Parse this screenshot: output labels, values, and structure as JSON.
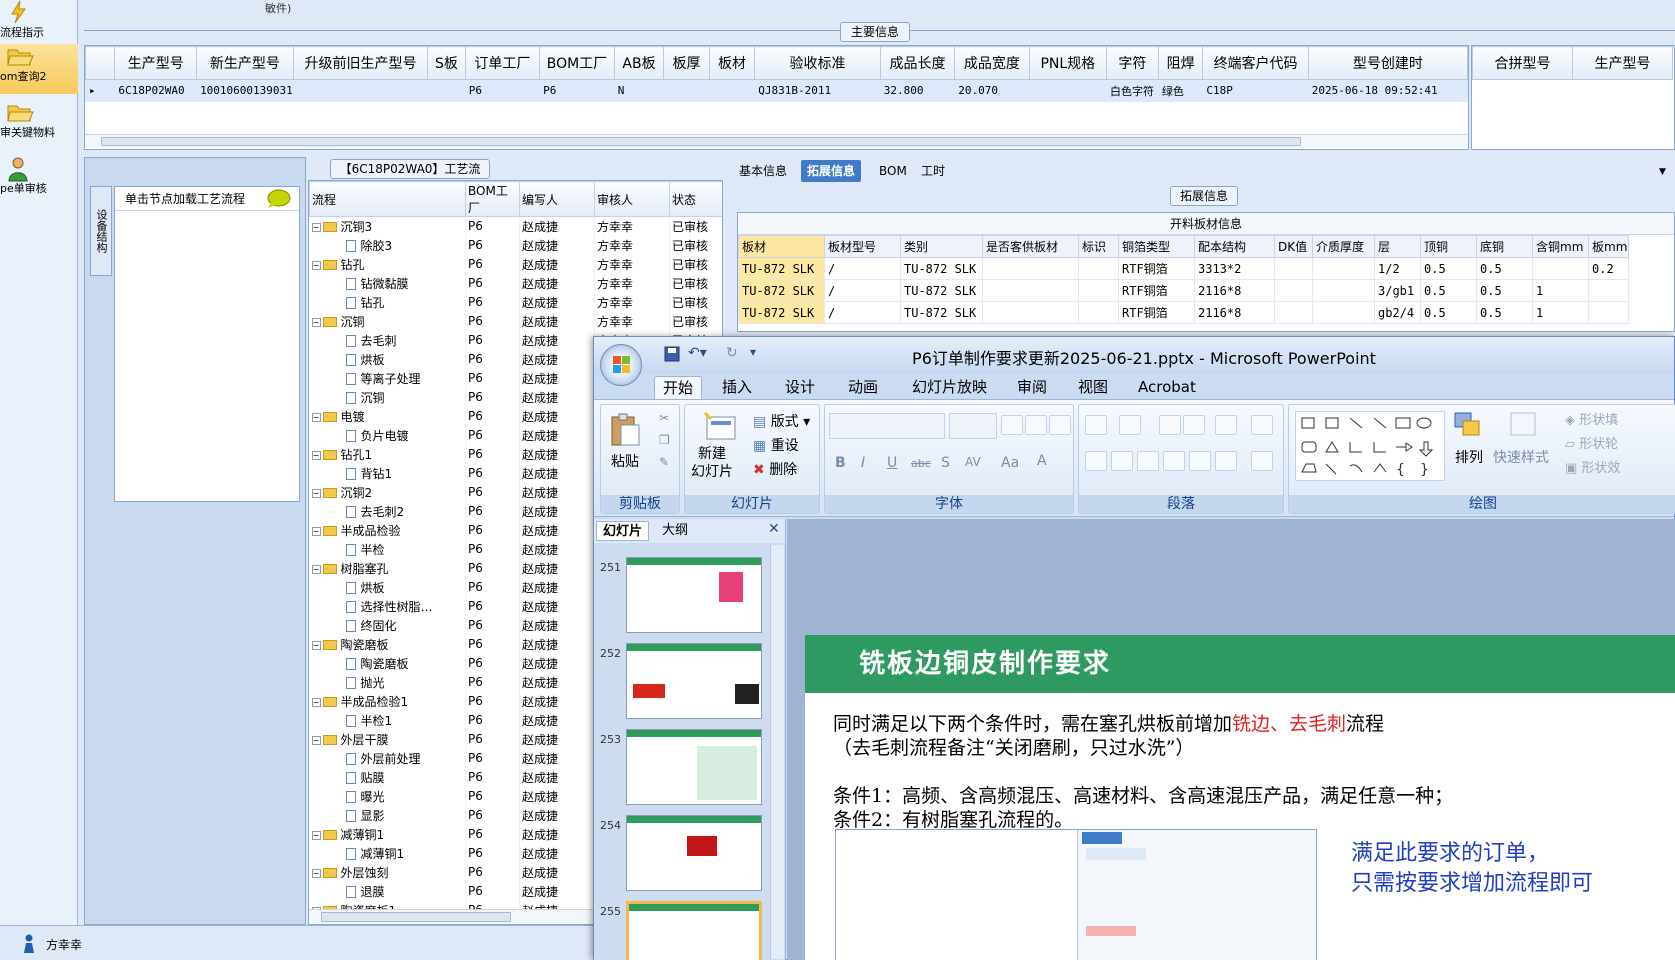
{
  "leftnav": {
    "items": [
      {
        "label": "流程指示",
        "icon": "lightning-icon"
      },
      {
        "label": "om查询2",
        "icon": "folder-open-icon"
      },
      {
        "label": "审关键物料",
        "icon": "folder-open-icon"
      },
      {
        "label": "pe单审核",
        "icon": "user-icon"
      }
    ],
    "top_text": "敏件)"
  },
  "status": {
    "user": "方幸幸"
  },
  "main": {
    "section_title": "主要信息",
    "columns": [
      "生产型号",
      "新生产型号",
      "升级前旧生产型号",
      "S板",
      "订单工厂",
      "BOM工厂",
      "AB板",
      "板厚",
      "板材",
      "验收标准",
      "成品长度",
      "成品宽度",
      "PNL规格",
      "字符",
      "阻焊",
      "终端客户代码",
      "型号创建时"
    ],
    "rows": [
      [
        "6C18P02WA0",
        "10010600139031",
        "",
        "",
        "P6",
        "P6",
        "N",
        "",
        "",
        "QJ831B-2011",
        "32.800",
        "20.070",
        "",
        "白色字符",
        "绿色",
        "C18P",
        "2025-06-18 09:52:41"
      ]
    ]
  },
  "right_grid": {
    "columns": [
      "合拼型号",
      "生产型号"
    ]
  },
  "process": {
    "title": "【6C18P02WA0】工艺流程",
    "vertical_tab": "设备结构",
    "load_hint": "单击节点加载工艺流程",
    "columns": [
      "流程",
      "BOM工厂",
      "编写人",
      "审核人",
      "状态"
    ],
    "rows": [
      {
        "name": "沉铜3",
        "type": "folder",
        "factory": "P6",
        "author": "赵成捷",
        "reviewer": "方幸幸",
        "status": "已审核"
      },
      {
        "name": "除胶3",
        "type": "doc",
        "factory": "P6",
        "author": "赵成捷",
        "reviewer": "方幸幸",
        "status": "已审核"
      },
      {
        "name": "钻孔",
        "type": "folder",
        "factory": "P6",
        "author": "赵成捷",
        "reviewer": "方幸幸",
        "status": "已审核"
      },
      {
        "name": "钻微黏膜",
        "type": "doc",
        "factory": "P6",
        "author": "赵成捷",
        "reviewer": "方幸幸",
        "status": "已审核"
      },
      {
        "name": "钻孔",
        "type": "doc",
        "factory": "P6",
        "author": "赵成捷",
        "reviewer": "方幸幸",
        "status": "已审核"
      },
      {
        "name": "沉铜",
        "type": "folder",
        "factory": "P6",
        "author": "赵成捷",
        "reviewer": "方幸幸",
        "status": "已审核"
      },
      {
        "name": "去毛刺",
        "type": "doc",
        "factory": "P6",
        "author": "赵成捷",
        "reviewer": "方幸幸",
        "status": "已审核"
      },
      {
        "name": "烘板",
        "type": "doc",
        "factory": "P6",
        "author": "赵成捷",
        "reviewer": "",
        "status": ""
      },
      {
        "name": "等离子处理",
        "type": "doc",
        "factory": "P6",
        "author": "赵成捷",
        "reviewer": "",
        "status": ""
      },
      {
        "name": "沉铜",
        "type": "doc",
        "factory": "P6",
        "author": "赵成捷",
        "reviewer": "",
        "status": ""
      },
      {
        "name": "电镀",
        "type": "folder",
        "factory": "P6",
        "author": "赵成捷",
        "reviewer": "",
        "status": ""
      },
      {
        "name": "负片电镀",
        "type": "doc",
        "factory": "P6",
        "author": "赵成捷",
        "reviewer": "",
        "status": ""
      },
      {
        "name": "钻孔1",
        "type": "folder",
        "factory": "P6",
        "author": "赵成捷",
        "reviewer": "",
        "status": ""
      },
      {
        "name": "背钻1",
        "type": "doc",
        "factory": "P6",
        "author": "赵成捷",
        "reviewer": "",
        "status": ""
      },
      {
        "name": "沉铜2",
        "type": "folder",
        "factory": "P6",
        "author": "赵成捷",
        "reviewer": "",
        "status": ""
      },
      {
        "name": "去毛刺2",
        "type": "doc",
        "factory": "P6",
        "author": "赵成捷",
        "reviewer": "",
        "status": ""
      },
      {
        "name": "半成品检验",
        "type": "folder",
        "factory": "P6",
        "author": "赵成捷",
        "reviewer": "",
        "status": ""
      },
      {
        "name": "半检",
        "type": "doc",
        "factory": "P6",
        "author": "赵成捷",
        "reviewer": "",
        "status": ""
      },
      {
        "name": "树脂塞孔",
        "type": "folder",
        "factory": "P6",
        "author": "赵成捷",
        "reviewer": "",
        "status": ""
      },
      {
        "name": "烘板",
        "type": "doc",
        "factory": "P6",
        "author": "赵成捷",
        "reviewer": "",
        "status": ""
      },
      {
        "name": "选择性树脂…",
        "type": "doc",
        "factory": "P6",
        "author": "赵成捷",
        "reviewer": "",
        "status": ""
      },
      {
        "name": "终固化",
        "type": "doc",
        "factory": "P6",
        "author": "赵成捷",
        "reviewer": "",
        "status": ""
      },
      {
        "name": "陶瓷磨板",
        "type": "folder",
        "factory": "P6",
        "author": "赵成捷",
        "reviewer": "",
        "status": ""
      },
      {
        "name": "陶瓷磨板",
        "type": "doc",
        "factory": "P6",
        "author": "赵成捷",
        "reviewer": "",
        "status": ""
      },
      {
        "name": "抛光",
        "type": "doc",
        "factory": "P6",
        "author": "赵成捷",
        "reviewer": "",
        "status": ""
      },
      {
        "name": "半成品检验1",
        "type": "folder",
        "factory": "P6",
        "author": "赵成捷",
        "reviewer": "",
        "status": ""
      },
      {
        "name": "半检1",
        "type": "doc",
        "factory": "P6",
        "author": "赵成捷",
        "reviewer": "",
        "status": ""
      },
      {
        "name": "外层干膜",
        "type": "folder",
        "factory": "P6",
        "author": "赵成捷",
        "reviewer": "",
        "status": ""
      },
      {
        "name": "外层前处理",
        "type": "doc",
        "factory": "P6",
        "author": "赵成捷",
        "reviewer": "",
        "status": ""
      },
      {
        "name": "贴膜",
        "type": "doc",
        "factory": "P6",
        "author": "赵成捷",
        "reviewer": "",
        "status": ""
      },
      {
        "name": "曝光",
        "type": "doc",
        "factory": "P6",
        "author": "赵成捷",
        "reviewer": "",
        "status": ""
      },
      {
        "name": "显影",
        "type": "doc",
        "factory": "P6",
        "author": "赵成捷",
        "reviewer": "",
        "status": ""
      },
      {
        "name": "减薄铜1",
        "type": "folder",
        "factory": "P6",
        "author": "赵成捷",
        "reviewer": "",
        "status": ""
      },
      {
        "name": "减薄铜1",
        "type": "doc",
        "factory": "P6",
        "author": "赵成捷",
        "reviewer": "",
        "status": ""
      },
      {
        "name": "外层蚀刻",
        "type": "folder",
        "factory": "P6",
        "author": "赵成捷",
        "reviewer": "",
        "status": ""
      },
      {
        "name": "退膜",
        "type": "doc",
        "factory": "P6",
        "author": "赵成捷",
        "reviewer": "",
        "status": ""
      },
      {
        "name": "陶瓷磨板1",
        "type": "folder",
        "factory": "P6",
        "author": "赵成捷",
        "reviewer": "",
        "status": ""
      }
    ]
  },
  "detail": {
    "tabs": [
      "基本信息",
      "拓展信息",
      "BOM",
      "工时"
    ],
    "active_tab": "拓展信息",
    "section_title": "拓展信息",
    "table_title": "开料板材信息",
    "columns": [
      "板材",
      "板材型号",
      "类别",
      "是否客供板材",
      "标识",
      "铜箔类型",
      "配本结构",
      "DK值",
      "介质厚度",
      "层",
      "顶铜",
      "底铜",
      "含铜mm",
      "板mm"
    ],
    "rows": [
      [
        "TU-872 SLK",
        "/",
        "TU-872 SLK",
        "",
        "",
        "RTF铜箔",
        "3313*2",
        "",
        "",
        "1/2",
        "0.5",
        "0.5",
        "",
        "0.2"
      ],
      [
        "TU-872 SLK",
        "/",
        "TU-872 SLK",
        "",
        "",
        "RTF铜箔",
        "2116*8",
        "",
        "",
        "3/gb1",
        "0.5",
        "0.5",
        "1",
        ""
      ],
      [
        "TU-872 SLK",
        "/",
        "TU-872 SLK",
        "",
        "",
        "RTF铜箔",
        "2116*8",
        "",
        "",
        "gb2/4",
        "0.5",
        "0.5",
        "1",
        ""
      ]
    ]
  },
  "ppt": {
    "title": "P6订单制作要求更新2025-06-21.pptx - Microsoft PowerPoint",
    "menu_tabs": [
      "开始",
      "插入",
      "设计",
      "动画",
      "幻灯片放映",
      "审阅",
      "视图",
      "Acrobat"
    ],
    "groups": {
      "clipboard": {
        "label": "剪贴板",
        "paste": "粘贴"
      },
      "slides": {
        "label": "幻灯片",
        "new_slide": "新建\n幻灯片",
        "layout": "版式",
        "reset": "重设",
        "delete": "删除"
      },
      "font": {
        "label": "字体"
      },
      "paragraph": {
        "label": "段落"
      },
      "drawing": {
        "label": "绘图",
        "arrange": "排列",
        "quick_styles": "快速样式",
        "shape_fill": "形状填",
        "shape_outline": "形状轮",
        "shape_effects": "形状效"
      }
    },
    "pane_tabs": [
      "幻灯片",
      "大纲"
    ],
    "slide_numbers": [
      "251",
      "252",
      "253",
      "254",
      "255"
    ],
    "slide": {
      "heading": "铣板边铜皮制作要求",
      "line1_a": "同时满足以下两个条件时，需在塞孔烘板前增加",
      "line1_red": "铣边、去毛刺",
      "line1_b": "流程",
      "line2": "（去毛刺流程备注“关闭磨刷，只过水洗”）",
      "cond1": "条件1：高频、含高频混压、高速材料、含高速混压产品，满足任意一种；",
      "cond2": "条件2：有树脂塞孔流程的。",
      "note1": "满足此要求的订单，",
      "note2": "只需按要求增加流程即可"
    },
    "colors": {
      "title_green": "#2e9a62",
      "red": "#e41d1d",
      "blue": "#1f3fbf"
    }
  }
}
